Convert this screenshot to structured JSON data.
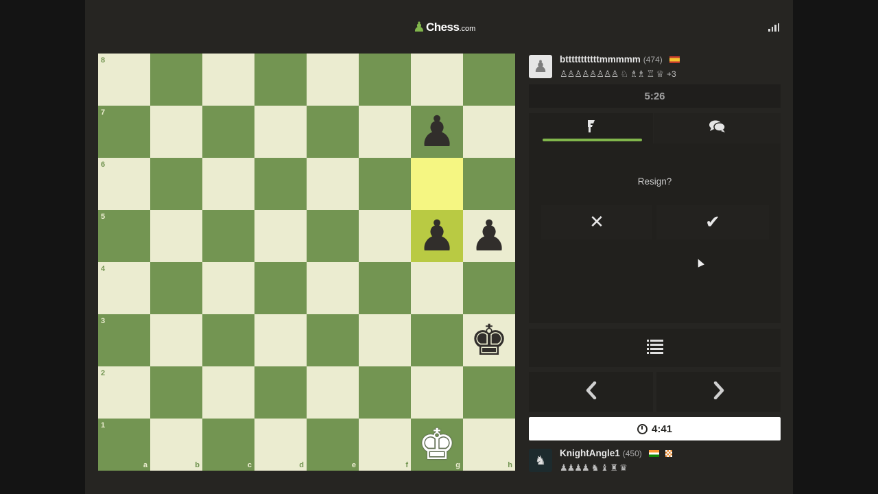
{
  "header": {
    "logo_text": "Chess",
    "logo_suffix": ".com"
  },
  "board": {
    "files": [
      "a",
      "b",
      "c",
      "d",
      "e",
      "f",
      "g",
      "h"
    ],
    "ranks": [
      "8",
      "7",
      "6",
      "5",
      "4",
      "3",
      "2",
      "1"
    ],
    "highlights": [
      "g6",
      "g5"
    ],
    "pieces": [
      {
        "square": "g7",
        "color": "black",
        "type": "pawn",
        "glyph": "♟"
      },
      {
        "square": "g5",
        "color": "black",
        "type": "pawn",
        "glyph": "♟"
      },
      {
        "square": "h5",
        "color": "black",
        "type": "pawn",
        "glyph": "♟"
      },
      {
        "square": "h3",
        "color": "black",
        "type": "king",
        "glyph": "♚"
      },
      {
        "square": "g1",
        "color": "white",
        "type": "king",
        "glyph": "♚"
      }
    ]
  },
  "opponent": {
    "name": "btttttttttttmmmmm",
    "rating": "(474)",
    "flag_colors": [
      "#f4c430",
      "#c0392b"
    ],
    "captured": "♙♙♙♙♙♙♙♙ ♘ ♗♗ ♖ ♕",
    "material": "+3",
    "clock": "5:26"
  },
  "tabs": {
    "moves_icon": "pawn-flag-icon",
    "chat_icon": "chat-icon"
  },
  "resign": {
    "question": "Resign?",
    "cancel_glyph": "✕",
    "confirm_glyph": "✔"
  },
  "nav": {
    "prev_glyph": "‹",
    "next_glyph": "›"
  },
  "player": {
    "name": "KnightAngle1",
    "rating": "(450)",
    "flag_colors": [
      "#ff9933",
      "#ffffff",
      "#138808"
    ],
    "captured": "♟♟♟♟ ♞ ♝ ♜ ♛",
    "clock": "4:41"
  },
  "colors": {
    "light_square": "#ebecd0",
    "dark_square": "#739552",
    "accent": "#81b64c"
  }
}
